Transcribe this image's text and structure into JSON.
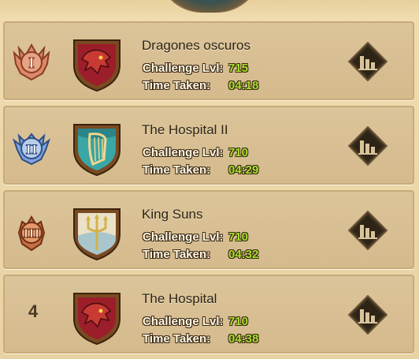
{
  "stat_labels": {
    "challenge": "Challenge Lvl:",
    "time": "Time Taken:"
  },
  "colors": {
    "card": "#d8c093",
    "value_green": "#a6e02c",
    "label_white": "#fff8e6"
  },
  "entries": [
    {
      "rank_badge": "rank-1-bronze-wings-icon",
      "team_crest": "red-dragon-crest-icon",
      "name": "Dragones oscuros",
      "challenge_lvl": "715",
      "time_taken": "04:18",
      "action_icon": "stats-chart-icon"
    },
    {
      "rank_badge": "rank-2-silver-wings-icon",
      "team_crest": "teal-harp-crest-icon",
      "name": "The Hospital II",
      "challenge_lvl": "710",
      "time_taken": "04:29",
      "action_icon": "stats-chart-icon"
    },
    {
      "rank_badge": "rank-3-bronze-icon",
      "team_crest": "white-trident-crest-icon",
      "name": "King Suns",
      "challenge_lvl": "710",
      "time_taken": "04:32",
      "action_icon": "stats-chart-icon"
    },
    {
      "rank": "4",
      "team_crest": "red-dragon-crest-icon",
      "name": "The Hospital",
      "challenge_lvl": "710",
      "time_taken": "04:38",
      "action_icon": "stats-chart-icon"
    }
  ]
}
